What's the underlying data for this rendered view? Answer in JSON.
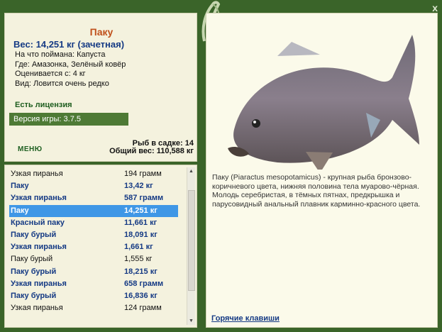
{
  "window": {
    "close_glyph": "x"
  },
  "catch": {
    "fish_name": "Паку",
    "weight_line": "Вес: 14,251 кг (зачетная)",
    "bait_line": "На что поймана: Капуста",
    "location_line": "Где: Амазонка, Зелёный ковёр",
    "valued_line": "Оценивается с: 4 кг",
    "rarity_line": "Вид: Ловится очень редко"
  },
  "status": {
    "license": "Есть лицензия",
    "version": "Версия игры: 3.7.5"
  },
  "stats": {
    "fish_count": "Рыб в садке: 14",
    "total_weight": "Общий вес: 110,588 кг"
  },
  "menu": {
    "label": "МЕНЮ"
  },
  "list": {
    "rows": [
      {
        "name": "Узкая пиранья",
        "weight": "194 грамм",
        "style": "plain"
      },
      {
        "name": "Паку",
        "weight": "13,42 кг",
        "style": "bold"
      },
      {
        "name": "Узкая пиранья",
        "weight": "587 грамм",
        "style": "bold"
      },
      {
        "name": "Паку",
        "weight": "14,251 кг",
        "style": "sel"
      },
      {
        "name": "Красный паку",
        "weight": "11,661 кг",
        "style": "bold"
      },
      {
        "name": "Паку бурый",
        "weight": "18,091 кг",
        "style": "bold"
      },
      {
        "name": "Узкая пиранья",
        "weight": "1,661 кг",
        "style": "bold"
      },
      {
        "name": "Паку бурый",
        "weight": "1,555 кг",
        "style": "plain"
      },
      {
        "name": "Паку бурый",
        "weight": "18,215 кг",
        "style": "bold"
      },
      {
        "name": "Узкая пиранья",
        "weight": "658 грамм",
        "style": "bold"
      },
      {
        "name": "Паку бурый",
        "weight": "16,836 кг",
        "style": "bold"
      },
      {
        "name": "Узкая пиранья",
        "weight": "124 грамм",
        "style": "plain"
      }
    ]
  },
  "detail": {
    "description": "Паку (Piaractus mesopotamicus) - крупная рыба бронзово-коричневого цвета, нижняя половина тела муарово-чёрная. Молодь серебристая, в тёмных пятнах, предкрышка и парусовидный анальный плавник карминно-красного цвета.",
    "hotkeys_label": "Горячие клавиши"
  },
  "colors": {
    "frame": "#3a6429",
    "panel": "#f4f2de",
    "selection": "#3f97e6",
    "accent": "#c0501b",
    "blue_text": "#153a84"
  }
}
